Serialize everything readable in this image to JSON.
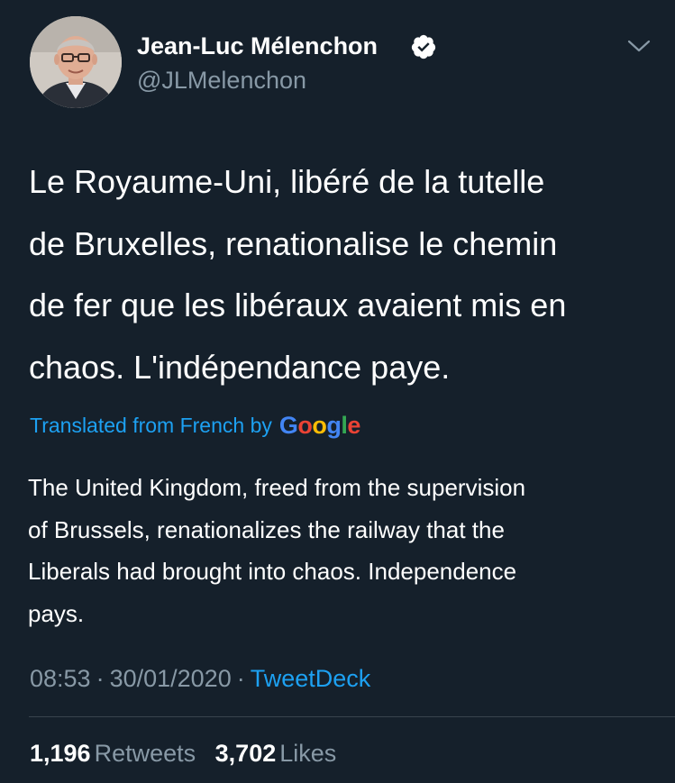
{
  "author": {
    "display_name": "Jean-Luc Mélenchon",
    "handle": "@JLMelenchon",
    "verified": true
  },
  "tweet": {
    "text_lines": [
      "Le Royaume-Uni, libéré de la tutelle",
      "de Bruxelles, renationalise le chemin",
      "de fer que les libéraux avaient mis en",
      "chaos. L'indépendance paye."
    ]
  },
  "translation": {
    "label": "Translated from French by",
    "provider": {
      "letters": [
        "G",
        "o",
        "o",
        "g",
        "l",
        "e"
      ],
      "colors": [
        "#4285f4",
        "#ea4335",
        "#fbbc05",
        "#4285f4",
        "#34a853",
        "#ea4335"
      ]
    },
    "text_lines": [
      "The United Kingdom, freed from the supervision",
      "of Brussels, renationalizes the railway that the",
      "Liberals had brought into chaos. Independence",
      "pays."
    ]
  },
  "meta": {
    "time": "08:53",
    "separator": "·",
    "date": "30/01/2020",
    "source": "TweetDeck"
  },
  "stats": {
    "retweets_count": "1,196",
    "retweets_label": "Retweets",
    "likes_count": "3,702",
    "likes_label": "Likes"
  },
  "icons": {
    "verified": "verified-badge-icon",
    "menu": "chevron-down-icon"
  },
  "colors": {
    "background": "#15202b",
    "accent": "#1da1f2",
    "secondary_text": "#8899a6",
    "divider": "#38444d"
  }
}
